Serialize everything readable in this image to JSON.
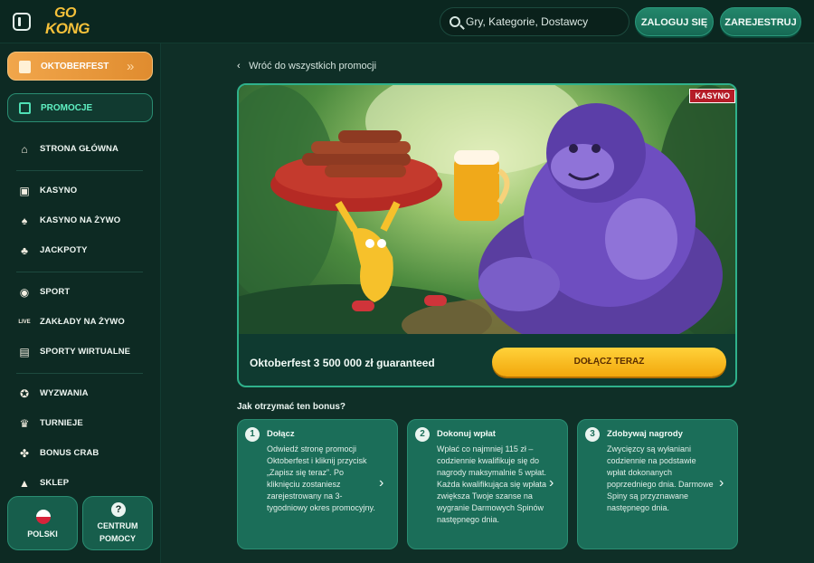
{
  "header": {
    "logo_line1": "GO",
    "logo_line2": "KONG",
    "search_placeholder": "Gry, Kategorie, Dostawcy",
    "login_label": "ZALOGUJ SIĘ",
    "register_label": "ZAREJESTRUJ"
  },
  "sidebar": {
    "featured": "OKTOBERFEST",
    "promotions": "PROMOCJE",
    "items": [
      {
        "label": "STRONA GŁÓWNA",
        "icon": "home-icon"
      },
      {
        "label": "KASYNO",
        "icon": "slot-machine-icon"
      },
      {
        "label": "KASYNO NA ŻYWO",
        "icon": "cards-icon"
      },
      {
        "label": "JACKPOTY",
        "icon": "clover-icon"
      },
      {
        "label": "SPORT",
        "icon": "ball-icon"
      },
      {
        "label": "ZAKŁADY NA ŻYWO",
        "icon": "live-icon"
      },
      {
        "label": "SPORTY WIRTUALNE",
        "icon": "virtual-icon"
      },
      {
        "label": "WYZWANIA",
        "icon": "medal-icon"
      },
      {
        "label": "TURNIEJE",
        "icon": "trophy-icon"
      },
      {
        "label": "BONUS CRAB",
        "icon": "crab-icon"
      },
      {
        "label": "SKLEP",
        "icon": "bag-icon"
      }
    ],
    "language": "POLSKI",
    "help_line1": "CENTRUM",
    "help_line2": "POMOCY"
  },
  "main": {
    "back_link": "Wróć do wszystkich promocji",
    "badge": "KASYNO",
    "promo_title": "Oktoberfest 3 500 000 zł guaranteed",
    "cta": "DOŁĄCZ TERAZ",
    "how_title": "Jak otrzymać ten bonus?",
    "steps": [
      {
        "num": "1",
        "title": "Dołącz",
        "desc": "Odwiedź stronę promocji Oktoberfest i kliknij przycisk „Zapisz się teraz”. Po kliknięciu zostaniesz zarejestrowany na 3-tygodniowy okres promocyjny."
      },
      {
        "num": "2",
        "title": "Dokonuj wpłat",
        "desc": "Wpłać co najmniej 115 zł – codziennie kwalifikuje się do nagrody maksymalnie 5 wpłat. Każda kwalifikująca się wpłata zwiększa Twoje szanse na wygranie Darmowych Spinów następnego dnia."
      },
      {
        "num": "3",
        "title": "Zdobywaj nagrody",
        "desc": "Zwycięzcy są wyłaniani codziennie na podstawie wpłat dokonanych poprzedniego dnia. Darmowe Spiny są przyznawane następnego dnia."
      }
    ]
  },
  "colors": {
    "bg": "#0f2f27",
    "accent": "#2fb18b",
    "cta": "#f2a70c",
    "featured": "#e08c2f",
    "badge": "#b51d28"
  }
}
